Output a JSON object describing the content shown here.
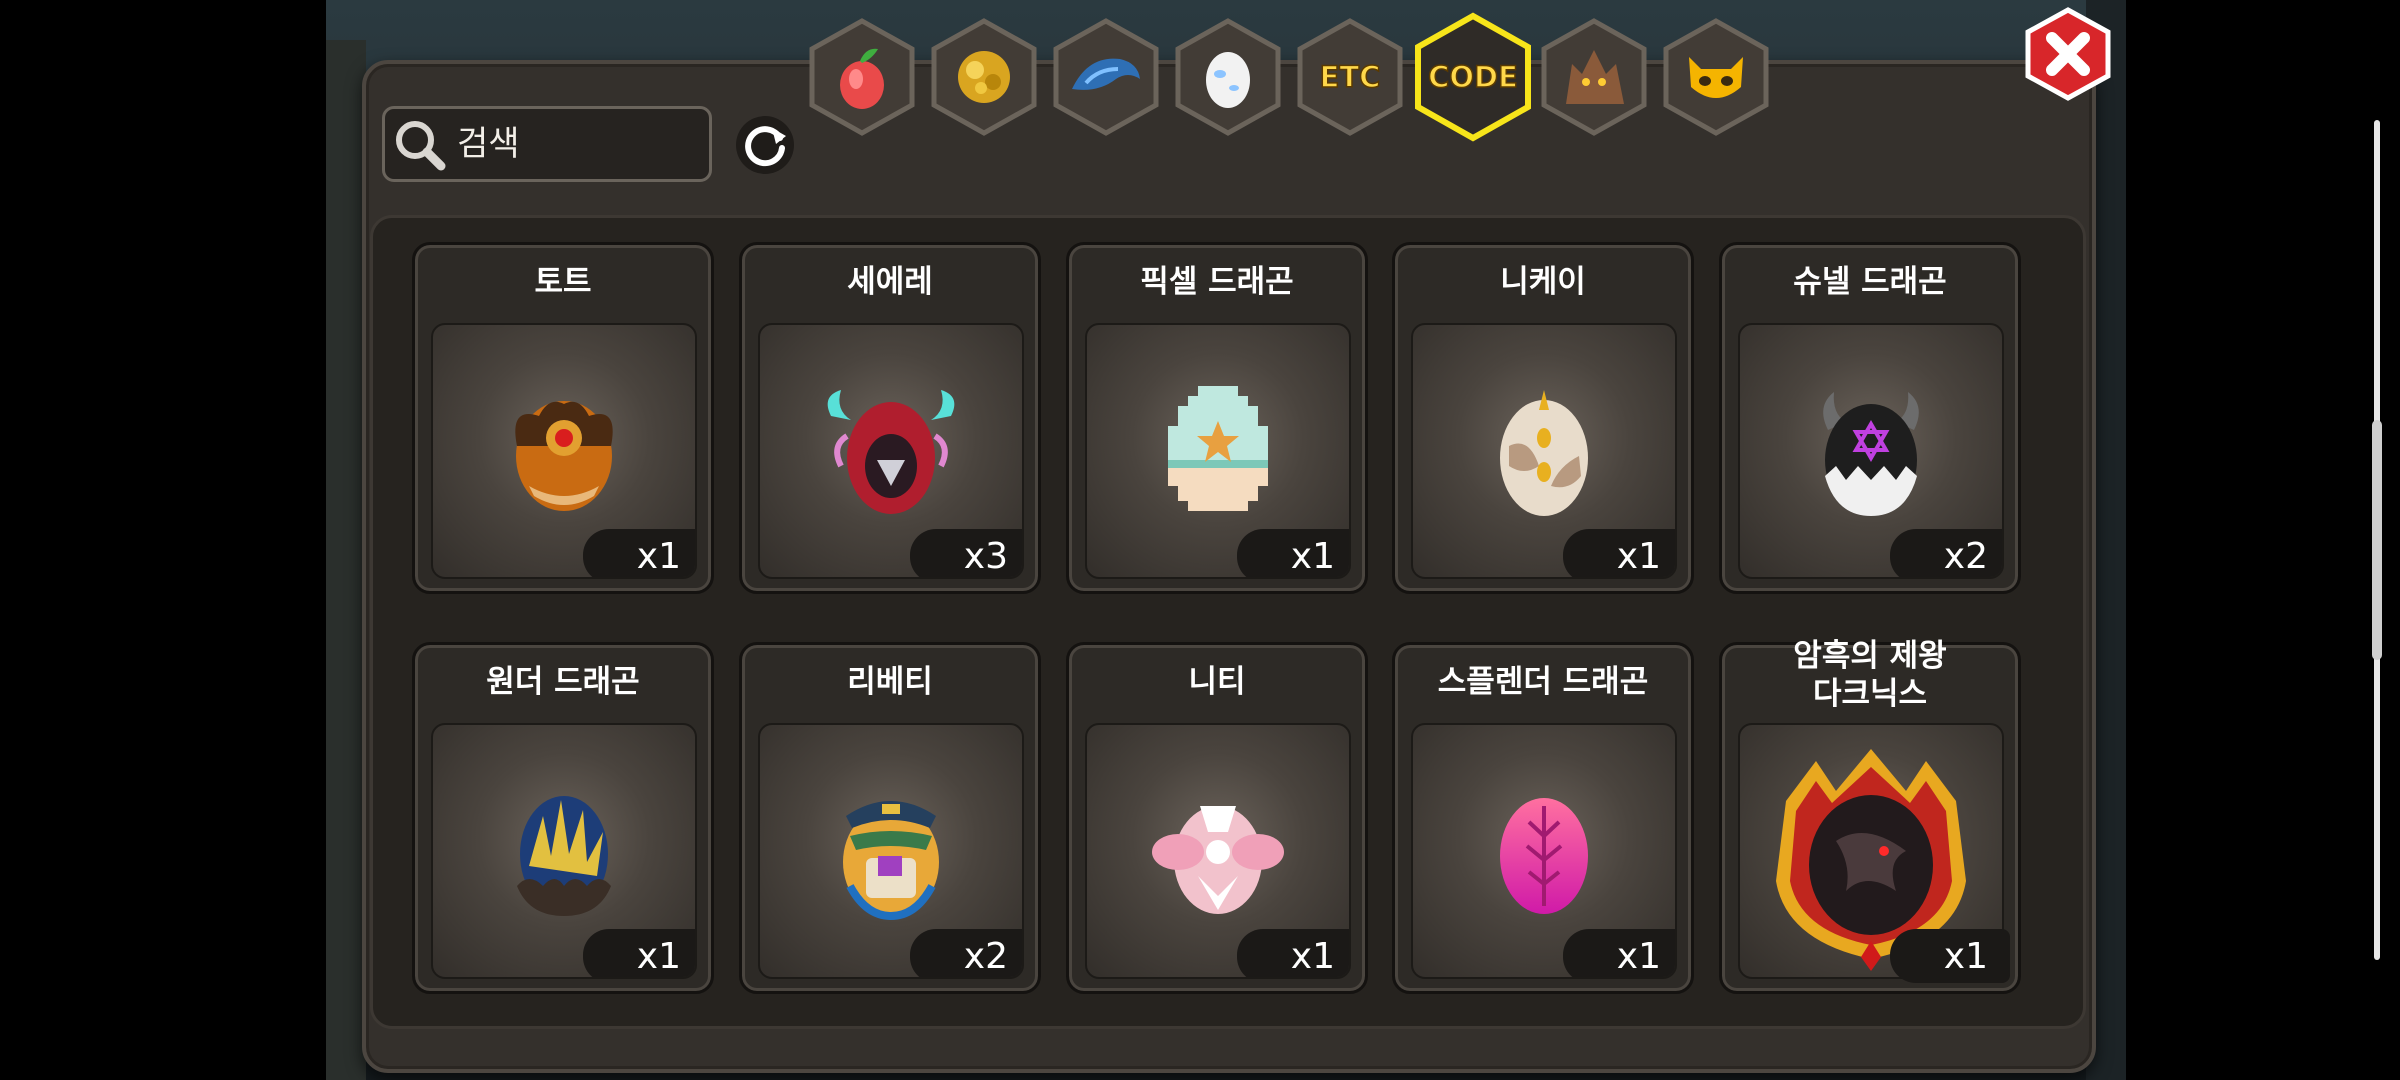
{
  "search": {
    "placeholder": "검색"
  },
  "tabs": [
    {
      "name": "fruit-tab-icon",
      "type": "icon"
    },
    {
      "name": "gold-tab-icon",
      "type": "icon"
    },
    {
      "name": "dragon-tab-icon",
      "type": "icon"
    },
    {
      "name": "egg-tab-icon",
      "type": "icon"
    },
    {
      "name": "etc-tab",
      "type": "text",
      "label": "ETC"
    },
    {
      "name": "code-tab",
      "type": "text",
      "label": "CODE",
      "selected": true
    },
    {
      "name": "beast-tab-icon",
      "type": "icon"
    },
    {
      "name": "mask-tab-icon",
      "type": "icon"
    }
  ],
  "items": [
    {
      "name": "토트",
      "qty": "x1",
      "egg": "dark-gold-egg"
    },
    {
      "name": "세에레",
      "qty": "x3",
      "egg": "hooded-egg"
    },
    {
      "name": "픽셀 드래곤",
      "qty": "x1",
      "egg": "pixel-egg"
    },
    {
      "name": "니케이",
      "qty": "x1",
      "egg": "cream-egg"
    },
    {
      "name": "슈넬 드래곤",
      "qty": "x2",
      "egg": "horned-egg"
    },
    {
      "name": "원더 드래곤",
      "qty": "x1",
      "egg": "spiky-egg"
    },
    {
      "name": "리베티",
      "qty": "x2",
      "egg": "police-egg"
    },
    {
      "name": "니티",
      "qty": "x1",
      "egg": "bow-egg"
    },
    {
      "name": "스플렌더 드래곤",
      "qty": "x1",
      "egg": "magenta-egg"
    },
    {
      "name": "암흑의 제왕 다크닉스",
      "qty": "x1",
      "egg": "dark-emperor-egg",
      "title_line1": "암흑의 제왕",
      "title_line2": "다크닉스"
    }
  ],
  "colors": {
    "selected_tab_glow": "#f7e51a",
    "close_button": "#d8262a",
    "tab_text": "#ffd84a"
  }
}
